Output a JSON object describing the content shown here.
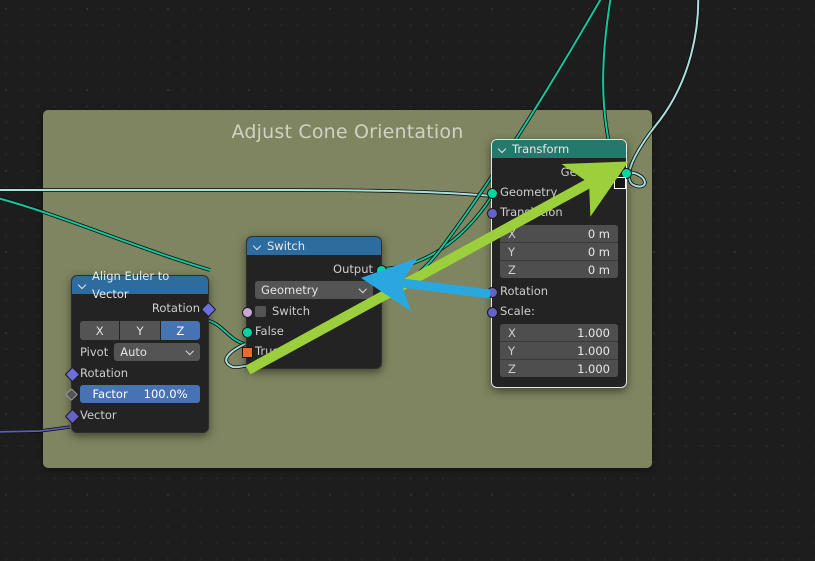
{
  "app": {
    "editor": "geometry-node-editor",
    "background_color": "#1d1d1d"
  },
  "frame": {
    "label": "Adjust Cone Orientation",
    "color": "#7e8560"
  },
  "nodes": [
    {
      "id": "align-euler-to-vector",
      "title": "Align Euler to Vector",
      "header_color": "#2e6c9e",
      "outputs": [
        {
          "name": "Rotation",
          "label": "Rotation",
          "socket_type": "rotation"
        }
      ],
      "axis_toggle": {
        "options": [
          "X",
          "Y",
          "Z"
        ],
        "selected": "Z"
      },
      "pivot": {
        "label": "Pivot",
        "value": "Auto"
      },
      "inputs": [
        {
          "name": "Rotation",
          "label": "Rotation",
          "socket_type": "field-diamond"
        },
        {
          "name": "Factor",
          "label": "Factor",
          "value": "100.0%",
          "socket_type": "field-hollow"
        },
        {
          "name": "Vector",
          "label": "Vector",
          "socket_type": "vector"
        }
      ]
    },
    {
      "id": "switch",
      "title": "Switch",
      "header_color": "#2e6c9e",
      "outputs": [
        {
          "name": "Output",
          "label": "Output",
          "socket_type": "geometry"
        }
      ],
      "data_type": {
        "label": "Geometry",
        "options": [
          "Geometry"
        ]
      },
      "inputs": [
        {
          "name": "Switch",
          "label": "Switch",
          "socket_type": "boolean",
          "checkbox": false
        },
        {
          "name": "False",
          "label": "False",
          "socket_type": "geometry"
        },
        {
          "name": "True",
          "label": "True",
          "socket_type": "geometry-linked"
        }
      ]
    },
    {
      "id": "transform",
      "title": "Transform",
      "header_color": "#24796c",
      "selected": true,
      "outputs": [
        {
          "name": "Geometry",
          "label": "Geometry",
          "socket_type": "geometry"
        }
      ],
      "inputs": [
        {
          "name": "Geometry",
          "label": "Geometry",
          "socket_type": "geometry"
        },
        {
          "name": "Translation",
          "label": "Translation",
          "socket_type": "vector"
        },
        {
          "name": "Rotation",
          "label": "Rotation",
          "socket_type": "vector"
        },
        {
          "name": "Scale",
          "label": "Scale:",
          "socket_type": "vector"
        }
      ],
      "translation": {
        "axes": [
          "X",
          "Y",
          "Z"
        ],
        "values": [
          "0 m",
          "0 m",
          "0 m"
        ]
      },
      "scale": {
        "axes": [
          "X",
          "Y",
          "Z"
        ],
        "values": [
          "1.000",
          "1.000",
          "1.000"
        ]
      }
    }
  ],
  "annotations": [
    {
      "name": "green-arrow",
      "color": "#9ccf3c",
      "from": "switch True socket",
      "to": "transform Geometry output"
    },
    {
      "name": "blue-arrow",
      "color": "#29a8e0",
      "from": "transform Rotation input",
      "to": "switch node"
    }
  ],
  "colors": {
    "geometry_socket": "#00d6a3",
    "vector_socket": "#6363c7",
    "boolean_socket": "#cca6d6",
    "rotation_socket": "#6d6ddc",
    "true_socket": "#ed6a2e",
    "link_geometry": "#17c69a",
    "link_highlight": "#a8e0dc",
    "link_vector": "#5c5cb0",
    "accent_blue": "#4772b3"
  }
}
